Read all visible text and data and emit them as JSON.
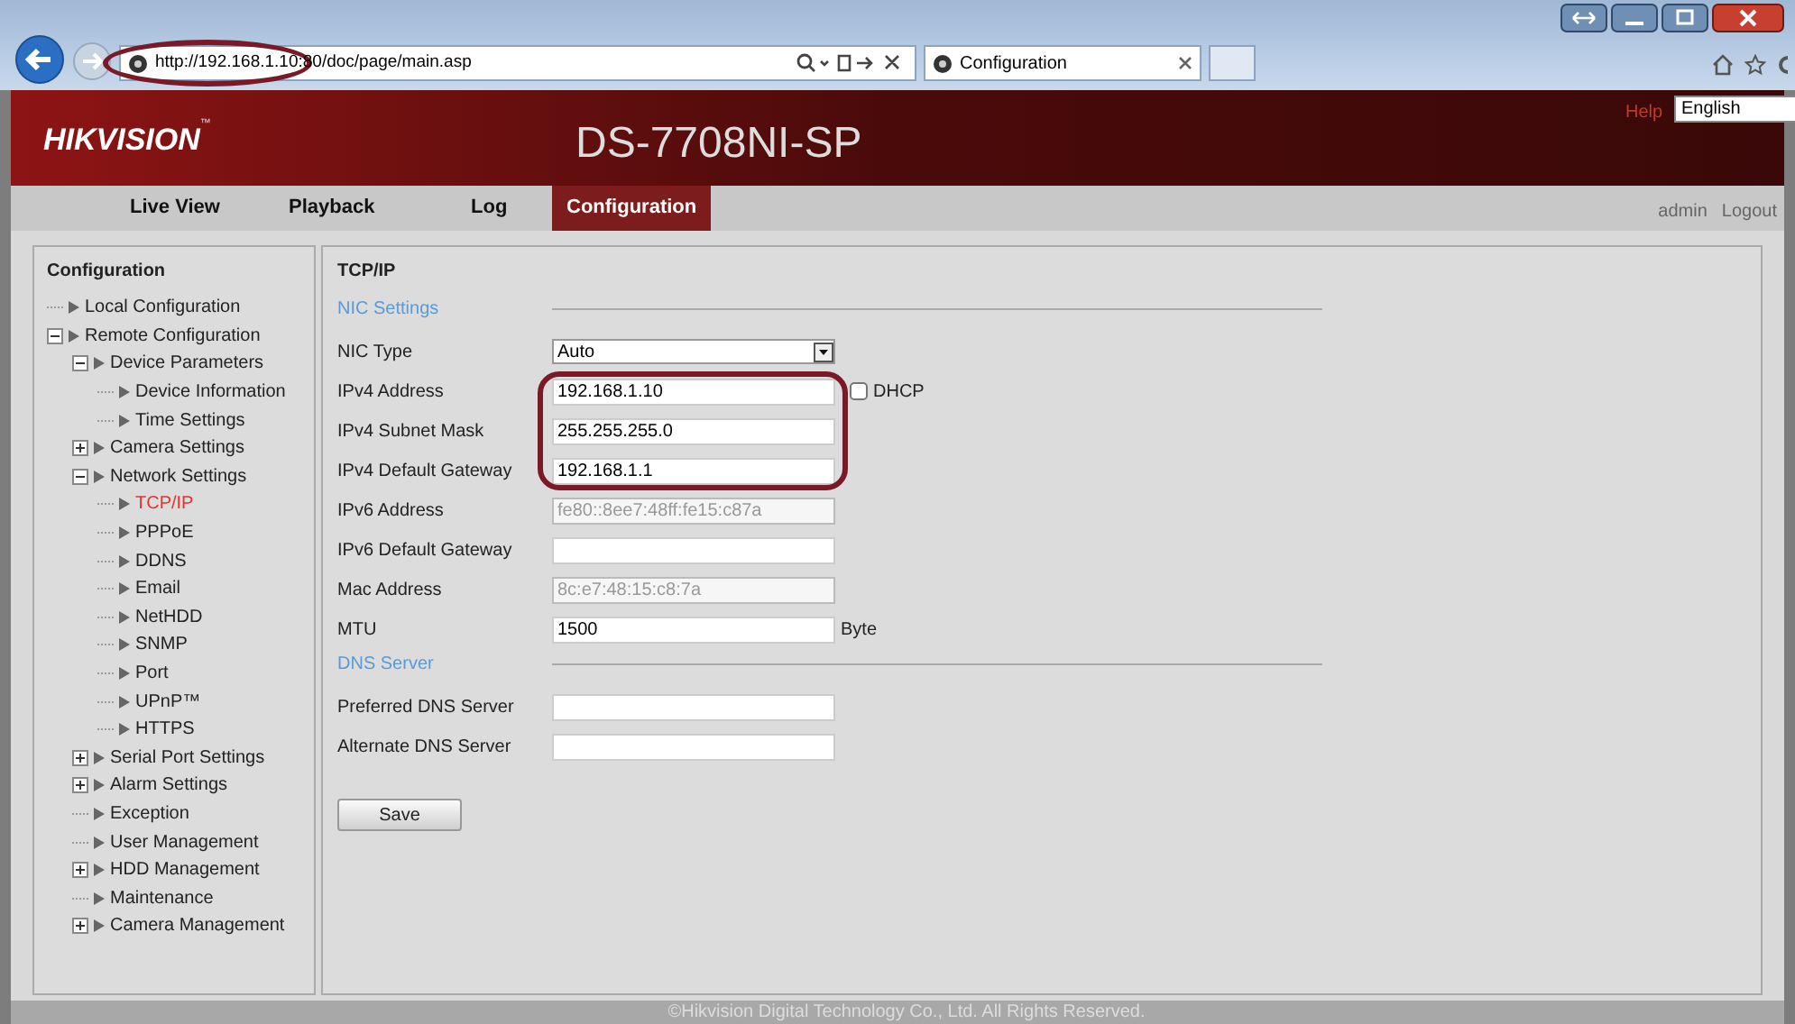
{
  "browser": {
    "address": "http://192.168.1.10:80/doc/page/main.asp",
    "tab": {
      "title": "Configuration",
      "selected": true
    }
  },
  "header": {
    "logo": "HIKVISION",
    "logo_mark": "™",
    "model": "DS-7708NI-SP",
    "help": "Help",
    "language": "English"
  },
  "nav": {
    "tabs": [
      {
        "label": "Live View",
        "selected": false
      },
      {
        "label": "Playback",
        "selected": false
      },
      {
        "label": "Log",
        "selected": false
      },
      {
        "label": "Configuration",
        "selected": true
      }
    ],
    "user": "admin",
    "logout": "Logout"
  },
  "sidebar": {
    "title": "Configuration",
    "items": [
      {
        "label": "Local Configuration",
        "selected": false
      },
      {
        "label": "Remote Configuration",
        "selected": false,
        "expanded": true,
        "children": [
          {
            "label": "Device Parameters",
            "selected": false,
            "expanded": true,
            "children": [
              {
                "label": "Device Information",
                "selected": false
              },
              {
                "label": "Time Settings",
                "selected": false
              }
            ]
          },
          {
            "label": "Camera Settings",
            "selected": false,
            "expanded": false
          },
          {
            "label": "Network Settings",
            "selected": false,
            "expanded": true,
            "children": [
              {
                "label": "TCP/IP",
                "selected": true
              },
              {
                "label": "PPPoE",
                "selected": false
              },
              {
                "label": "DDNS",
                "selected": false
              },
              {
                "label": "Email",
                "selected": false
              },
              {
                "label": "NetHDD",
                "selected": false
              },
              {
                "label": "SNMP",
                "selected": false
              },
              {
                "label": "Port",
                "selected": false
              },
              {
                "label": "UPnP™",
                "selected": false
              },
              {
                "label": "HTTPS",
                "selected": false
              }
            ]
          },
          {
            "label": "Serial Port Settings",
            "selected": false,
            "expanded": false
          },
          {
            "label": "Alarm Settings",
            "selected": false,
            "expanded": false
          },
          {
            "label": "Exception",
            "selected": false
          },
          {
            "label": "User Management",
            "selected": false
          },
          {
            "label": "HDD Management",
            "selected": false,
            "expanded": false
          },
          {
            "label": "Maintenance",
            "selected": false
          },
          {
            "label": "Camera Management",
            "selected": false,
            "expanded": false
          }
        ]
      }
    ]
  },
  "panel": {
    "title": "TCP/IP",
    "sections": [
      {
        "heading": "NIC Settings",
        "fields": [
          {
            "kind": "select",
            "label": "NIC Type",
            "value": "Auto",
            "highlighted": false
          },
          {
            "kind": "text",
            "label": "IPv4 Address",
            "value": "192.168.1.10",
            "disabled": false,
            "highlighted": true,
            "checkbox": {
              "label": "DHCP",
              "checked": false
            }
          },
          {
            "kind": "text",
            "label": "IPv4 Subnet Mask",
            "value": "255.255.255.0",
            "disabled": false,
            "highlighted": true
          },
          {
            "kind": "text",
            "label": "IPv4 Default Gateway",
            "value": "192.168.1.1",
            "disabled": false,
            "highlighted": true
          },
          {
            "kind": "text",
            "label": "IPv6 Address",
            "value": "fe80::8ee7:48ff:fe15:c87a",
            "disabled": true,
            "highlighted": false
          },
          {
            "kind": "text",
            "label": "IPv6 Default Gateway",
            "disabled": false,
            "highlighted": false
          },
          {
            "kind": "text",
            "label": "Mac Address",
            "value": "8c:e7:48:15:c8:7a",
            "disabled": true,
            "highlighted": false
          },
          {
            "kind": "text",
            "label": "MTU",
            "value": "1500",
            "disabled": false,
            "highlighted": false,
            "unit": "Byte"
          }
        ]
      },
      {
        "heading": "DNS Server",
        "fields": [
          {
            "kind": "text",
            "label": "Preferred DNS Server",
            "disabled": false,
            "highlighted": false
          },
          {
            "kind": "text",
            "label": "Alternate DNS Server",
            "disabled": false,
            "highlighted": false
          }
        ]
      }
    ],
    "save": "Save"
  },
  "footer": "©Hikvision Digital Technology Co., Ltd. All Rights Reserved."
}
